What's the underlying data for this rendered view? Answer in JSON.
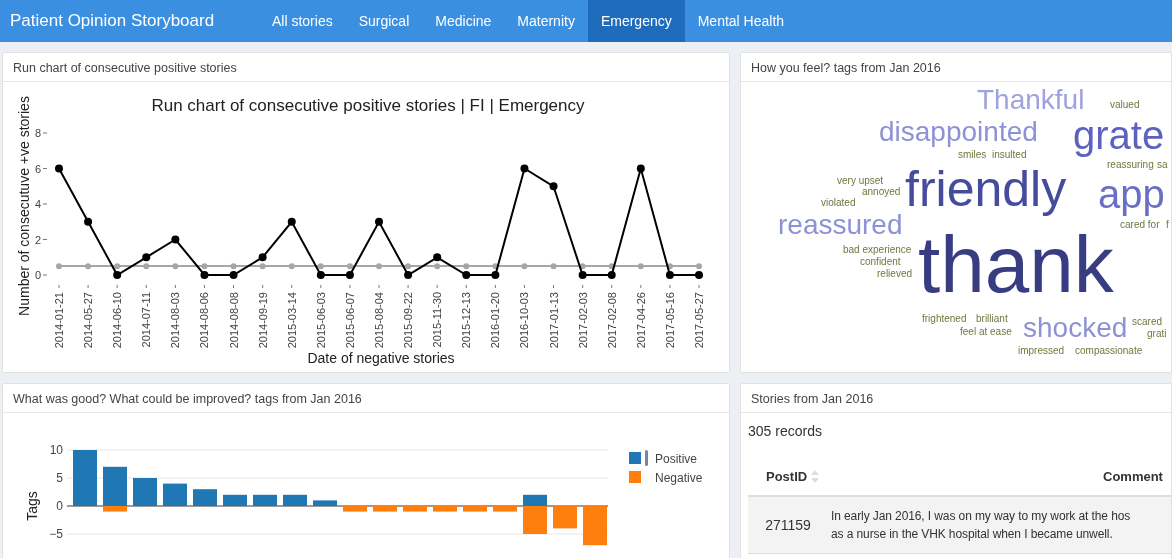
{
  "navbar": {
    "title": "Patient Opinion Storyboard",
    "tabs": [
      {
        "label": "All stories",
        "selected": false
      },
      {
        "label": "Surgical",
        "selected": false
      },
      {
        "label": "Medicine",
        "selected": false
      },
      {
        "label": "Maternity",
        "selected": false
      },
      {
        "label": "Emergency",
        "selected": true
      },
      {
        "label": "Mental Health",
        "selected": false
      }
    ]
  },
  "run_chart_panel": {
    "header": "Run chart of consecutive positive stories",
    "chart_data": {
      "type": "line",
      "title": "Run chart of consecutive positive stories | FI | Emergency",
      "xlabel": "Date of negative stories",
      "ylabel": "Number of consecutuve +ve stories",
      "categories": [
        "2014-01-21",
        "2014-05-27",
        "2014-06-10",
        "2014-07-11",
        "2014-08-03",
        "2014-08-06",
        "2014-08-08",
        "2014-09-19",
        "2015-03-14",
        "2015-06-03",
        "2015-06-07",
        "2015-08-04",
        "2015-09-22",
        "2015-11-30",
        "2015-12-13",
        "2016-01-20",
        "2016-10-03",
        "2017-01-13",
        "2017-02-03",
        "2017-02-08",
        "2017-04-26",
        "2017-05-16",
        "2017-05-27"
      ],
      "series": [
        {
          "color": "#000000",
          "marker": true,
          "values": [
            6,
            3,
            0,
            1,
            2,
            0,
            0,
            1,
            3,
            0,
            0,
            3,
            0,
            1,
            0,
            0,
            6,
            5,
            0,
            0,
            6,
            0,
            0
          ]
        },
        {
          "color": "#a6a6a6",
          "marker": true,
          "values": [
            0.5,
            0.5,
            0.5,
            0.5,
            0.5,
            0.5,
            0.5,
            0.5,
            0.5,
            0.5,
            0.5,
            0.5,
            0.5,
            0.5,
            0.5,
            0.5,
            0.5,
            0.5,
            0.5,
            0.5,
            0.5,
            0.5,
            0.5
          ]
        }
      ],
      "ylim": [
        0,
        8
      ],
      "yticks": [
        0,
        2,
        4,
        6,
        8
      ]
    }
  },
  "word_cloud_panel": {
    "header": "How you feel? tags from Jan 2016",
    "words": [
      {
        "text": "Thankful"
      },
      {
        "text": "valued"
      },
      {
        "text": "disappointed"
      },
      {
        "text": "smiles"
      },
      {
        "text": "insulted"
      },
      {
        "text": "grate"
      },
      {
        "text": "reassuring"
      },
      {
        "text": "sa"
      },
      {
        "text": "very upset"
      },
      {
        "text": "annoyed"
      },
      {
        "text": "violated"
      },
      {
        "text": "friendly"
      },
      {
        "text": "app"
      },
      {
        "text": "reassured"
      },
      {
        "text": "bad experience"
      },
      {
        "text": "confident"
      },
      {
        "text": "relieved"
      },
      {
        "text": "thank"
      },
      {
        "text": "cared for"
      },
      {
        "text": "f"
      },
      {
        "text": "frightened"
      },
      {
        "text": "brilliant"
      },
      {
        "text": "shocked"
      },
      {
        "text": "scared"
      },
      {
        "text": "feel at ease"
      },
      {
        "text": "impressed"
      },
      {
        "text": "compassionate"
      },
      {
        "text": "grati"
      }
    ]
  },
  "tags_panel": {
    "header": "What was good? What could be improved? tags from Jan 2016",
    "chart_data": {
      "type": "bar",
      "ylabel": "Tags",
      "stacked": true,
      "series": [
        {
          "name": "Positive",
          "color": "#1f77b4",
          "values": [
            10,
            7,
            5,
            4,
            3,
            2,
            2,
            2,
            1,
            0,
            0,
            0,
            0,
            0,
            0,
            2,
            0,
            0
          ]
        },
        {
          "name": "Negative",
          "color": "#ff7f0e",
          "values": [
            0,
            -1,
            0,
            0,
            0,
            0,
            0,
            0,
            0,
            -1,
            -1,
            -1,
            -1,
            -1,
            -1,
            -5,
            -4,
            -7
          ]
        }
      ],
      "ylim": [
        -7,
        10
      ],
      "grid": true,
      "yticks": [
        {
          "value": -5,
          "label": "−5"
        },
        0,
        5,
        10
      ]
    }
  },
  "stories_panel": {
    "header": "Stories from Jan 2016",
    "record_count": "305 records",
    "columns": [
      "PostID",
      "Comment"
    ],
    "rows": [
      {
        "post_id": "271159",
        "comment": "In early Jan 2016, I was on my way to my work at the hos\nas a nurse in the VHK hospital when I became unwell."
      }
    ]
  }
}
